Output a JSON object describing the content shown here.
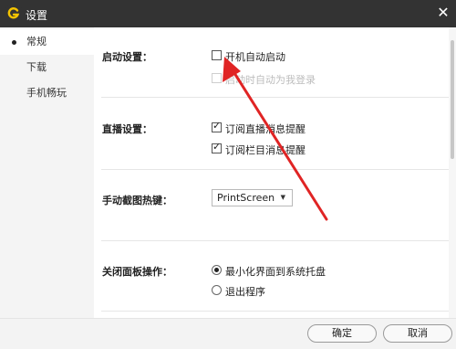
{
  "window": {
    "title": "设置",
    "logo_letter": "G"
  },
  "sidebar": {
    "items": [
      {
        "label": "常规",
        "active": true
      },
      {
        "label": "下载",
        "active": false
      },
      {
        "label": "手机畅玩",
        "active": false
      }
    ]
  },
  "startup": {
    "label": "启动设置：",
    "options": [
      {
        "label": "开机自动启动",
        "checked": false,
        "disabled": false
      },
      {
        "label": "启动时自动为我登录",
        "checked": false,
        "disabled": true
      }
    ]
  },
  "live": {
    "label": "直播设置：",
    "options": [
      {
        "label": "订阅直播消息提醒",
        "checked": true
      },
      {
        "label": "订阅栏目消息提醒",
        "checked": true
      }
    ]
  },
  "screenshot": {
    "label": "手动截图热键：",
    "hotkey": "PrintScreen"
  },
  "close_panel": {
    "label": "关闭面板操作：",
    "options": [
      {
        "label": "最小化界面到系统托盘",
        "selected": true
      },
      {
        "label": "退出程序",
        "selected": false
      }
    ]
  },
  "footer": {
    "ok_label": "确定",
    "cancel_label": "取消"
  },
  "colors": {
    "titlebar": "#333333",
    "logo": "#f5c400",
    "annotation_arrow": "#e02424"
  }
}
